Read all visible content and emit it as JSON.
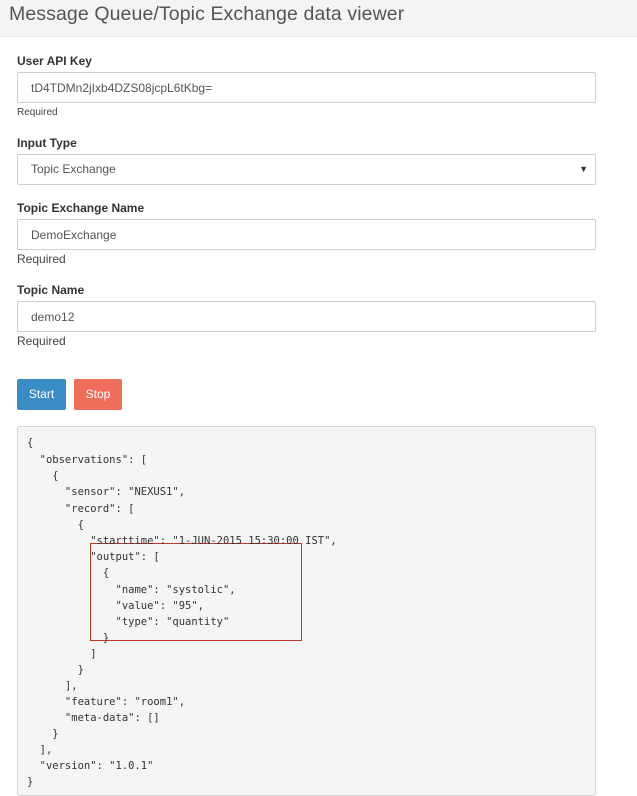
{
  "header": {
    "title": "Message Queue/Topic Exchange data viewer"
  },
  "form": {
    "api_key": {
      "label": "User API Key",
      "value": "tD4TDMn2jIxb4DZS08jcpL6tKbg=",
      "help": "Required"
    },
    "input_type": {
      "label": "Input Type",
      "value": "Topic Exchange"
    },
    "exchange_name": {
      "label": "Topic Exchange Name",
      "value": "DemoExchange",
      "help": "Required"
    },
    "topic_name": {
      "label": "Topic Name",
      "value": "demo12",
      "help": "Required"
    }
  },
  "buttons": {
    "start": "Start",
    "stop": "Stop"
  },
  "output": {
    "lines": [
      "{",
      "  \"observations\": [",
      "    {",
      "      \"sensor\": \"NEXUS1\",",
      "      \"record\": [",
      "        {",
      "          \"starttime\": \"1-JUN-2015 15:30:00 IST\",",
      "          \"output\": [",
      "            {",
      "              \"name\": \"systolic\",",
      "              \"value\": \"95\",",
      "              \"type\": \"quantity\"",
      "            }",
      "          ]",
      "        }",
      "      ],",
      "      \"feature\": \"room1\",",
      "      \"meta-data\": []",
      "    }",
      "  ],",
      "  \"version\": \"1.0.1\"",
      "}"
    ]
  },
  "colors": {
    "start_button": "#3a8dc4",
    "stop_button": "#ef6e5b",
    "highlight_border": "#c0392b"
  }
}
